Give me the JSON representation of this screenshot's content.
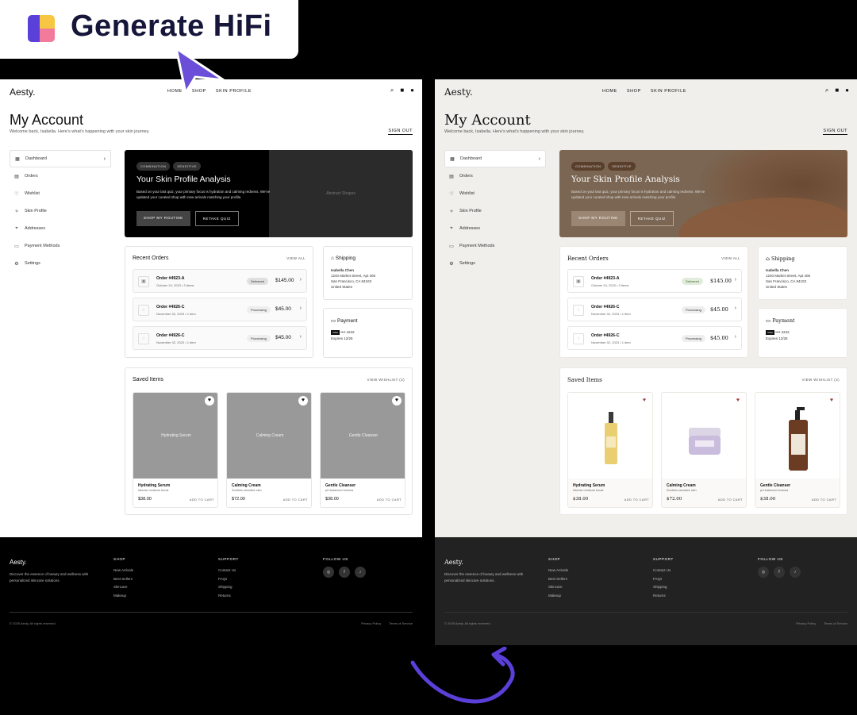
{
  "badge": {
    "title": "Generate HiFi"
  },
  "page": {
    "brand": "Aesty.",
    "nav": [
      "HOME",
      "SHOP",
      "SKIN PROFILE"
    ],
    "heading": "My Account",
    "welcome": "Welcome back, Isabella. Here's what's happening with your skin journey.",
    "signout": "SIGN OUT",
    "sidebar": [
      {
        "label": "Dashboard",
        "icon": "grid-icon"
      },
      {
        "label": "Orders",
        "icon": "box-icon"
      },
      {
        "label": "Wishlist",
        "icon": "heart-icon"
      },
      {
        "label": "Skin Profile",
        "icon": "sparkle-icon"
      },
      {
        "label": "Addresses",
        "icon": "pin-icon"
      },
      {
        "label": "Payment Methods",
        "icon": "card-icon"
      },
      {
        "label": "Settings",
        "icon": "gear-icon"
      }
    ],
    "hero": {
      "tags": [
        "COMBINATION",
        "SENSITIVE"
      ],
      "title": "Your Skin Profile Analysis",
      "desc": "Based on your last quiz, your primary focus is hydration and calming redness. We've updated your curated shop with new arrivals matching your profile.",
      "primary": "SHOP MY ROUTINE",
      "secondary": "RETAKE QUIZ",
      "placeholder": "Abstract Shapes"
    },
    "orders": {
      "title": "Recent Orders",
      "link": "VIEW ALL",
      "rows": [
        {
          "no": "Order #4923-A",
          "date": "October 24, 2023 • 3 items",
          "status": "Delivered",
          "price": "$145.00"
        },
        {
          "no": "Order #4926-C",
          "date": "November 02, 2023 • 1 item",
          "status": "Processing",
          "price": "$45.00"
        },
        {
          "no": "Order #4926-C",
          "date": "November 02, 2023 • 1 item",
          "status": "Processing",
          "price": "$45.00"
        }
      ]
    },
    "shipping": {
      "title": "Shipping",
      "name": "Isabella Chen",
      "line1": "1240 Market Street, Apt 405",
      "line2": "San Francisco, CA 94103",
      "line3": "United States"
    },
    "payment": {
      "title": "Payment",
      "card_brand": "VISA",
      "card": "•••• 4242",
      "expiry": "Expires 12/26"
    },
    "saved": {
      "title": "Saved Items",
      "link": "VIEW WISHLIST (3)",
      "items": [
        {
          "name": "Hydrating Serum",
          "desc": "Intense moisture boost",
          "price": "$38.00",
          "action": "ADD TO CART"
        },
        {
          "name": "Calming Cream",
          "desc": "Soothes sensitive skin",
          "price": "$72.00",
          "action": "ADD TO CART"
        },
        {
          "name": "Gentle Cleanser",
          "desc": "pH-balanced formula",
          "price": "$38.00",
          "action": "ADD TO CART"
        }
      ]
    },
    "footer": {
      "brand": "Aesty.",
      "desc": "Discover the essence of beauty and wellness with personalized skincare solutions.",
      "shop_title": "SHOP",
      "shop": [
        "New Arrivals",
        "Best Sellers",
        "Skincare",
        "Makeup"
      ],
      "support_title": "SUPPORT",
      "support": [
        "Contact Us",
        "FAQs",
        "Shipping",
        "Returns"
      ],
      "follow_title": "FOLLOW US",
      "social": [
        "instagram-icon",
        "facebook-icon",
        "tiktok-icon"
      ],
      "copyright": "© 2025 Aesty. All rights reserved.",
      "privacy": "Privacy Policy",
      "terms": "Terms of Service"
    }
  },
  "colors": {
    "accent": "#5b3fd9",
    "dark_footer": "#222222",
    "hero_brown": "#7a6653",
    "cream_bg": "#f1efeb"
  }
}
